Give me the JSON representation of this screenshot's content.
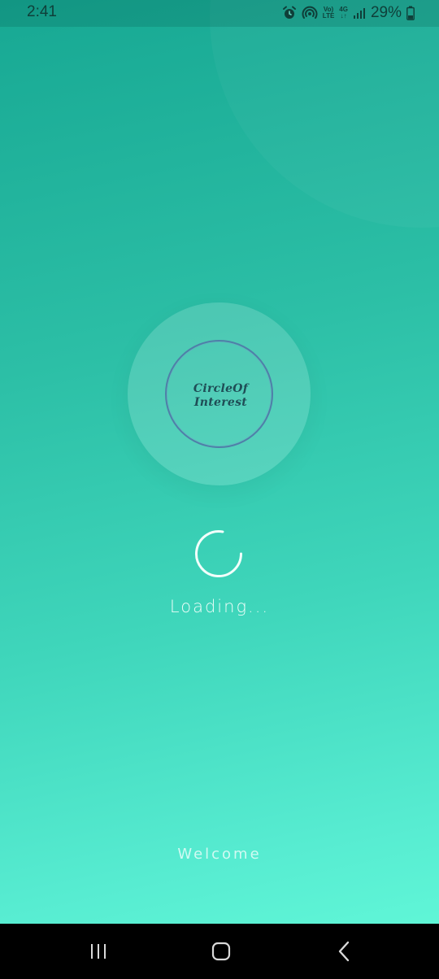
{
  "status_bar": {
    "time": "2:41",
    "volte_top": "Vo)",
    "volte_bottom": "LTE",
    "net_type": "4G",
    "battery_percent": "29%",
    "icons": [
      "alarm-icon",
      "hotspot-icon",
      "volte-icon",
      "network-4g-icon",
      "signal-icon",
      "battery-icon"
    ]
  },
  "logo": {
    "line1": "CircleOf",
    "line2": "Interest"
  },
  "loading": {
    "text": "Loading..."
  },
  "footer": {
    "welcome": "Welcome"
  },
  "nav_bar": {
    "icons": [
      "recent-apps-icon",
      "home-icon",
      "back-icon"
    ]
  },
  "colors": {
    "gradient_top": "#17a893",
    "gradient_bottom": "#64fbda",
    "logo_ring": "#4f7fa8",
    "nav_bar": "#000000"
  }
}
